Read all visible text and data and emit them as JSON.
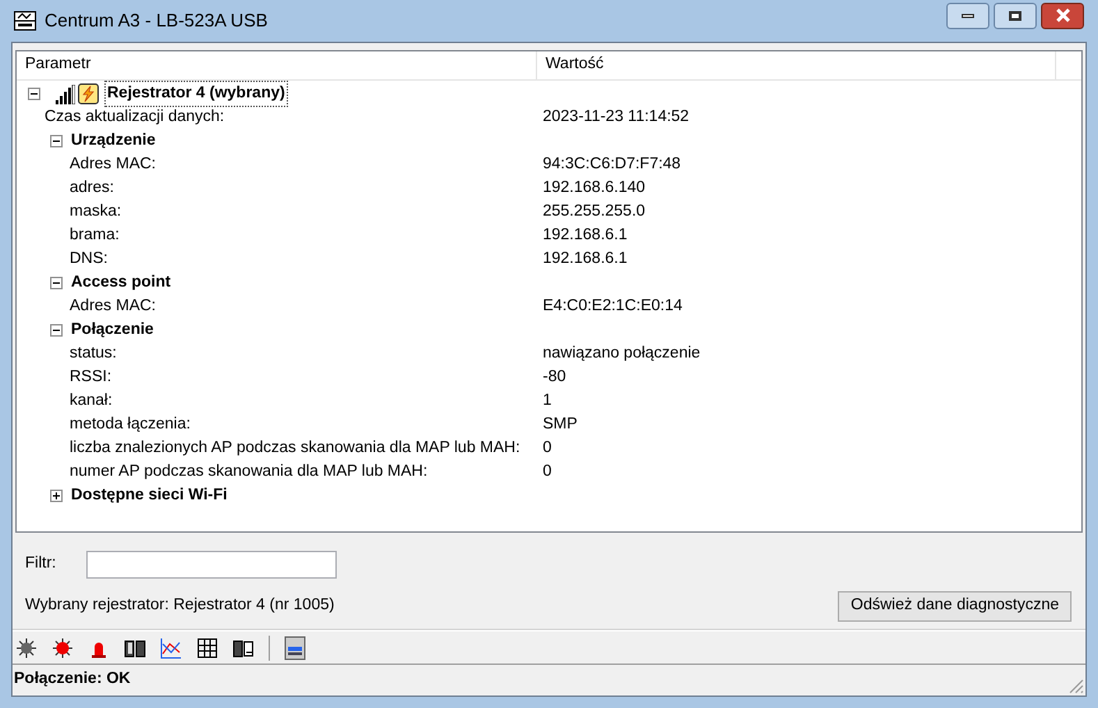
{
  "window": {
    "title": "Centrum A3 - LB-523A USB"
  },
  "table": {
    "columns": [
      "Parametr",
      "Wartość"
    ],
    "tree": [
      {
        "label": "Rejestrator 4 (wybrany)",
        "focused": true,
        "expanded": true,
        "children": [
          {
            "name": "Czas aktualizacji danych:",
            "value": "2023-11-23 11:14:52"
          },
          {
            "label": "Urządzenie",
            "expanded": true,
            "children": [
              {
                "name": "Adres MAC:",
                "value": "94:3C:C6:D7:F7:48"
              },
              {
                "name": "adres:",
                "value": "192.168.6.140"
              },
              {
                "name": "maska:",
                "value": "255.255.255.0"
              },
              {
                "name": "brama:",
                "value": "192.168.6.1"
              },
              {
                "name": "DNS:",
                "value": "192.168.6.1"
              }
            ]
          },
          {
            "label": "Access point",
            "expanded": true,
            "children": [
              {
                "name": "Adres MAC:",
                "value": "E4:C0:E2:1C:E0:14"
              }
            ]
          },
          {
            "label": "Połączenie",
            "expanded": true,
            "children": [
              {
                "name": "status:",
                "value": "nawiązano połączenie"
              },
              {
                "name": "RSSI:",
                "value": "-80"
              },
              {
                "name": "kanał:",
                "value": "1"
              },
              {
                "name": "metoda łączenia:",
                "value": "SMP"
              },
              {
                "name": "liczba znalezionych AP podczas skanowania dla MAP lub MAH:",
                "value": "0"
              },
              {
                "name": "numer AP podczas skanowania dla MAP lub MAH:",
                "value": "0"
              }
            ]
          },
          {
            "label": "Dostępne sieci Wi-Fi",
            "expanded": false
          }
        ]
      }
    ]
  },
  "filter": {
    "label": "Filtr:"
  },
  "selected_info": "Wybrany rejestrator: Rejestrator 4 (nr 1005)",
  "refresh_button": "Odśwież dane diagnostyczne",
  "status_bar": "Połączenie: OK"
}
